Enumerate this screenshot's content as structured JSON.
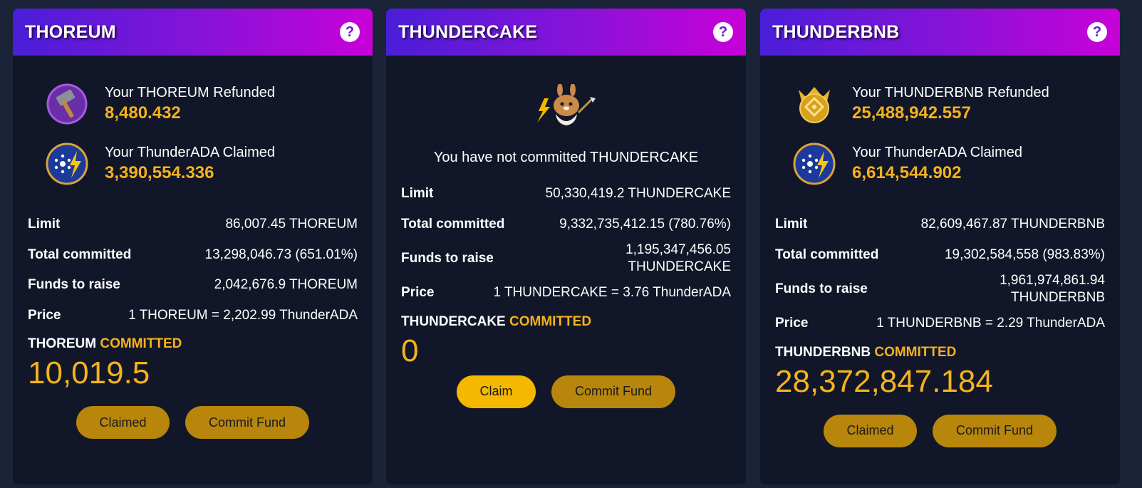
{
  "cards": [
    {
      "title": "THOREUM",
      "help_label": "?",
      "rows": [
        {
          "label": "Your THOREUM Refunded",
          "value": "8,480.432",
          "icon": "hammer-icon"
        },
        {
          "label": "Your ThunderADA Claimed",
          "value": "3,390,554.336",
          "icon": "cardano-thunder-icon"
        }
      ],
      "stats": [
        {
          "k": "Limit",
          "v": "86,007.45 THOREUM"
        },
        {
          "k": "Total committed",
          "v": "13,298,046.73 (651.01%)"
        },
        {
          "k": "Funds to raise",
          "v": "2,042,676.9 THOREUM"
        },
        {
          "k": "Price",
          "v": "1 THOREUM = 2,202.99 ThunderADA"
        }
      ],
      "committed_token": "THOREUM",
      "committed_word": "COMMITTED",
      "committed_value": "10,019.5",
      "btn1": "Claimed",
      "btn2": "Commit Fund"
    },
    {
      "title": "THUNDERCAKE",
      "help_label": "?",
      "icon": "thundercake-bunny-icon",
      "notice": "You have not committed THUNDERCAKE",
      "stats": [
        {
          "k": "Limit",
          "v": "50,330,419.2 THUNDERCAKE"
        },
        {
          "k": "Total committed",
          "v": "9,332,735,412.15 (780.76%)"
        },
        {
          "k": "Funds to raise",
          "v1": "1,195,347,456.05",
          "v2": "THUNDERCAKE"
        },
        {
          "k": "Price",
          "v": "1 THUNDERCAKE = 3.76 ThunderADA"
        }
      ],
      "committed_token": "THUNDERCAKE",
      "committed_word": "COMMITTED",
      "committed_value": "0",
      "btn1": "Claim",
      "btn2": "Commit Fund"
    },
    {
      "title": "THUNDERBNB",
      "help_label": "?",
      "rows": [
        {
          "label": "Your THUNDERBNB Refunded",
          "value": "25,488,942.557",
          "icon": "bnb-crown-icon"
        },
        {
          "label": "Your ThunderADA Claimed",
          "value": "6,614,544.902",
          "icon": "cardano-thunder-icon"
        }
      ],
      "stats": [
        {
          "k": "Limit",
          "v": "82,609,467.87 THUNDERBNB"
        },
        {
          "k": "Total committed",
          "v": "19,302,584,558 (983.83%)"
        },
        {
          "k": "Funds to raise",
          "v1": "1,961,974,861.94",
          "v2": "THUNDERBNB"
        },
        {
          "k": "Price",
          "v": "1 THUNDERBNB = 2.29 ThunderADA"
        }
      ],
      "committed_token": "THUNDERBNB",
      "committed_word": "COMMITTED",
      "committed_value": "28,372,847.184",
      "btn1": "Claimed",
      "btn2": "Commit Fund"
    }
  ]
}
